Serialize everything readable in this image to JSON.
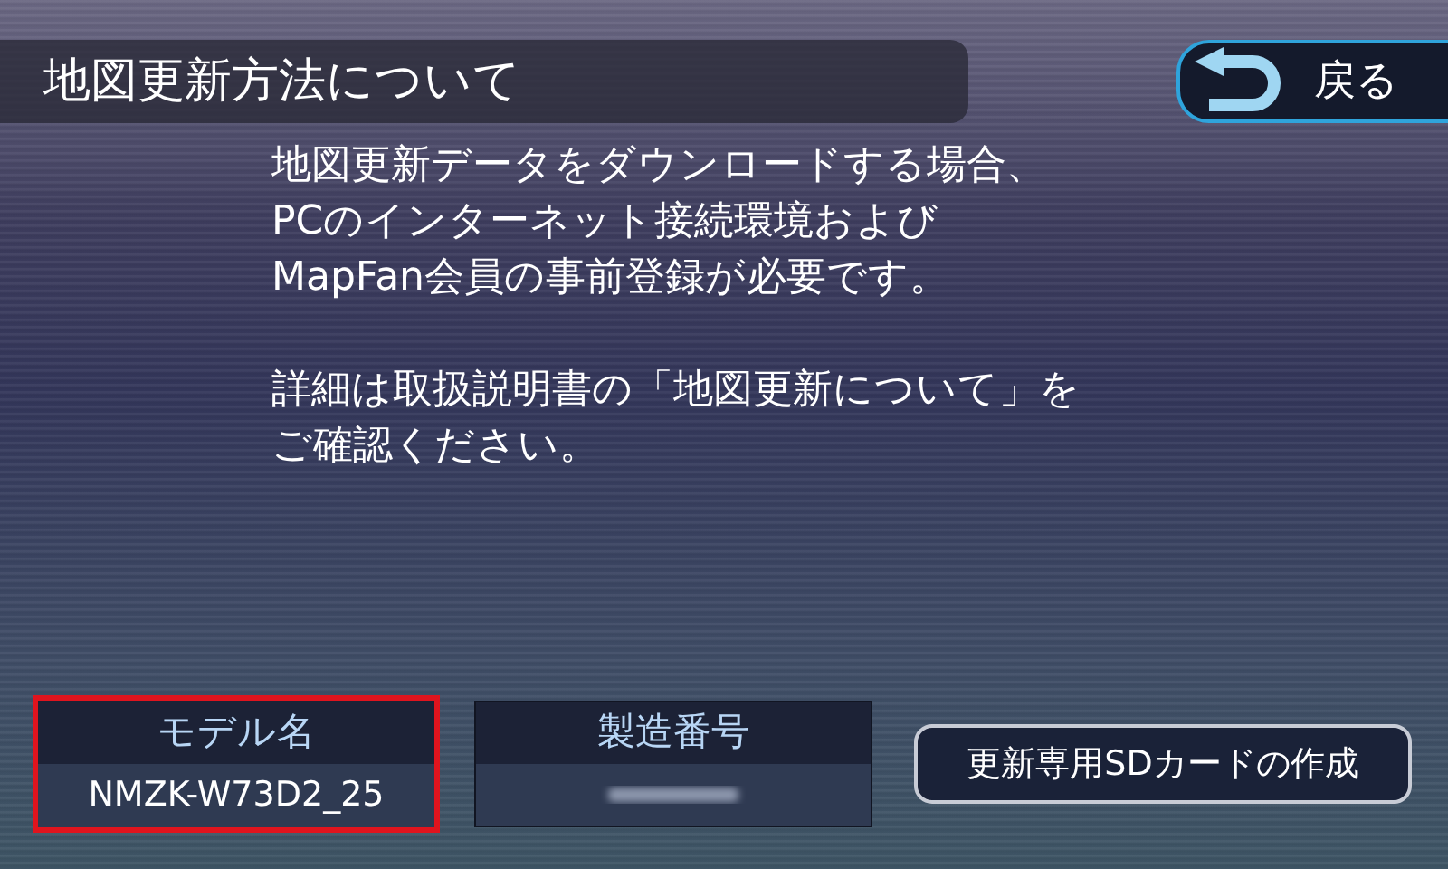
{
  "header": {
    "title": "地図更新方法について"
  },
  "back_button": {
    "label": "戻る"
  },
  "message": {
    "paragraphs": [
      [
        "地図更新データをダウンロードする場合、",
        "PCのインターネット接続環境および",
        "MapFan会員の事前登録が必要です。"
      ],
      [
        "詳細は取扱説明書の「地図更新について」を",
        "ご確認ください。"
      ]
    ]
  },
  "info_fields": [
    {
      "label": "モデル名",
      "value": "NMZK-W73D2_25",
      "value_redacted": false,
      "highlighted": true
    },
    {
      "label": "製造番号",
      "value_redacted": true,
      "highlighted": false
    }
  ],
  "action_button": {
    "label": "更新専用SDカードの作成"
  }
}
